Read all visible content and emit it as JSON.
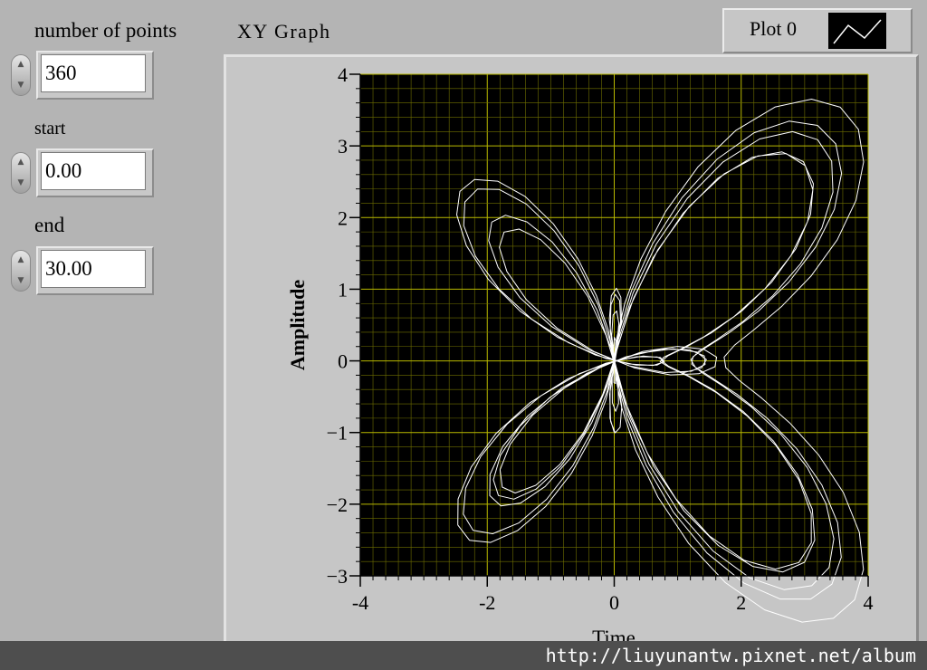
{
  "controls": {
    "num_points": {
      "label": "number of points",
      "value": "360"
    },
    "start": {
      "label": "start",
      "value": "0.00"
    },
    "end": {
      "label": "end",
      "value": "30.00"
    }
  },
  "graph": {
    "title": "XY Graph",
    "legend": {
      "plot_name": "Plot 0"
    }
  },
  "chart_data": {
    "type": "line",
    "xlabel": "Time",
    "ylabel": "Amplitude",
    "xlim": [
      -4,
      4
    ],
    "ylim": [
      -3,
      4
    ],
    "xticks": [
      "-4",
      "-2",
      "0",
      "2",
      "4"
    ],
    "yticks": [
      "-3",
      "-2",
      "-1",
      "0",
      "1",
      "2",
      "3",
      "4"
    ],
    "grid": true,
    "legend": "top-right",
    "series": [
      {
        "name": "Plot 0",
        "curve": "butterfly",
        "t_range": [
          0,
          30
        ],
        "points": 360
      }
    ],
    "colors": {
      "background": "#000000",
      "grid": "#6f6f00",
      "grid_major": "#b8b800",
      "line": "#ffffff"
    }
  },
  "watermark": {
    "text": "http://liuyunantw.pixnet.net/album"
  }
}
